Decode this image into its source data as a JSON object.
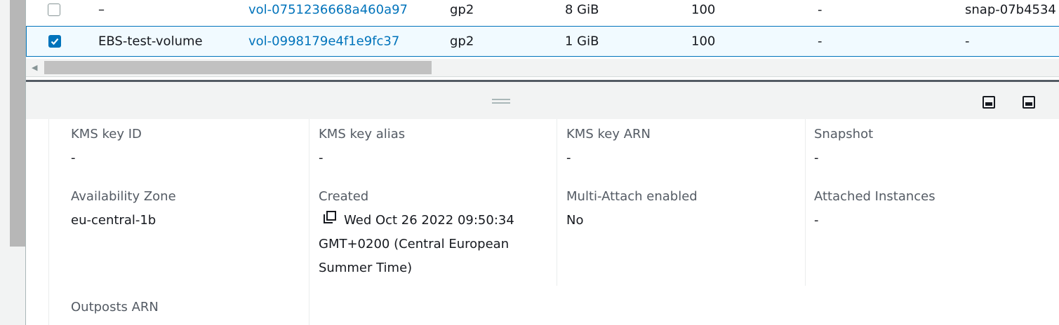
{
  "table": {
    "rows": [
      {
        "selected": false,
        "name": "–",
        "volume_id": "vol-0751236668a460a97",
        "type": "gp2",
        "size": "8 GiB",
        "iops": "100",
        "throughput": "-",
        "snapshot": "snap-07b4534"
      },
      {
        "selected": true,
        "name": "EBS-test-volume",
        "volume_id": "vol-0998179e4f1e9fc37",
        "type": "gp2",
        "size": "1 GiB",
        "iops": "100",
        "throughput": "-",
        "snapshot": "-"
      }
    ]
  },
  "details": {
    "kms_key_id": {
      "label": "KMS key ID",
      "value": "-"
    },
    "kms_key_alias": {
      "label": "KMS key alias",
      "value": "-"
    },
    "kms_key_arn": {
      "label": "KMS key ARN",
      "value": "-"
    },
    "snapshot": {
      "label": "Snapshot",
      "value": "-"
    },
    "availability_zone": {
      "label": "Availability Zone",
      "value": "eu-central-1b"
    },
    "created": {
      "label": "Created",
      "value": "Wed Oct 26 2022 09:50:34 GMT+0200 (Central European Summer Time)"
    },
    "multi_attach": {
      "label": "Multi-Attach enabled",
      "value": "No"
    },
    "attached_instances": {
      "label": "Attached Instances",
      "value": "-"
    },
    "outposts_arn": {
      "label": "Outposts ARN"
    }
  },
  "icons": {
    "copy": "copy-icon",
    "checkbox_checked": "checkmark-icon",
    "split_view_bottom": "split-panel-bottom-icon",
    "split_view_side": "split-panel-side-icon",
    "drag": "drag-handle-icon"
  },
  "colors": {
    "link": "#0073bb",
    "selected_row_bg": "#f1faff",
    "selected_row_border": "#0073bb",
    "label_text": "#545b64"
  }
}
